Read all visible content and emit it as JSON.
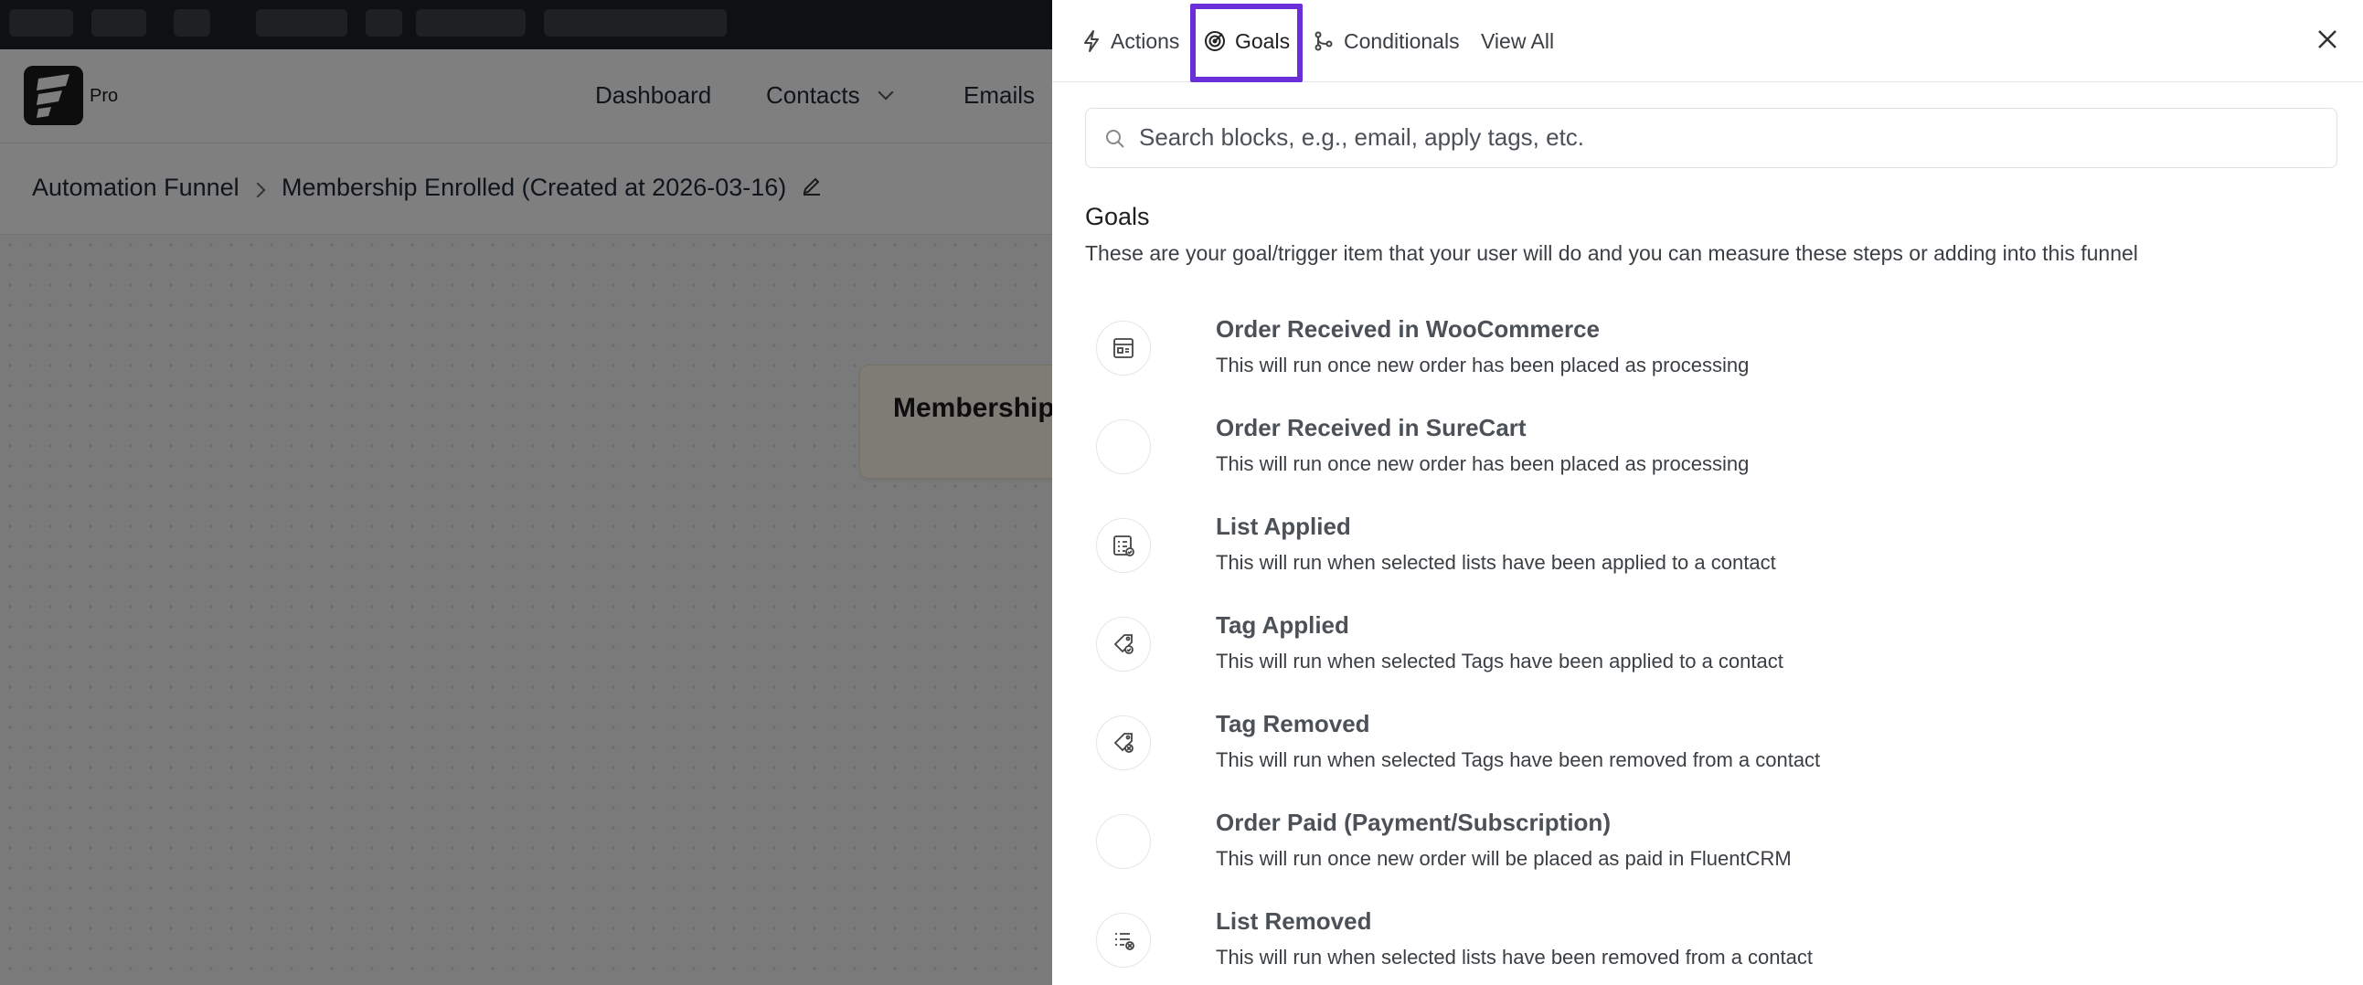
{
  "app": {
    "logo_suffix": "Pro",
    "nav": [
      {
        "label": "Dashboard"
      },
      {
        "label": "Contacts"
      },
      {
        "label": "Emails"
      }
    ],
    "breadcrumb": {
      "root": "Automation Funnel",
      "current": "Membership Enrolled (Created at 2026-03-16)"
    },
    "trigger_card_label": "Membership"
  },
  "panel": {
    "tabs": [
      {
        "label": "Actions",
        "icon": "lightning-icon"
      },
      {
        "label": "Goals",
        "icon": "target-icon",
        "active": true
      },
      {
        "label": "Conditionals",
        "icon": "branch-icon"
      },
      {
        "label": "View All"
      }
    ],
    "search": {
      "placeholder": "Search blocks, e.g., email, apply tags, etc."
    },
    "section": {
      "title": "Goals",
      "description": "These are your goal/trigger item that your user will do and you can measure these steps or adding into this funnel"
    },
    "goals": [
      {
        "title": "Order Received in WooCommerce",
        "desc": "This will run once new order has been placed as processing",
        "icon": "order-icon"
      },
      {
        "title": "Order Received in SureCart",
        "desc": "This will run once new order has been placed as processing",
        "icon": "blank-icon"
      },
      {
        "title": "List Applied",
        "desc": "This will run when selected lists have been applied to a contact",
        "icon": "list-icon"
      },
      {
        "title": "Tag Applied",
        "desc": "This will run when selected Tags have been applied to a contact",
        "icon": "tag-icon"
      },
      {
        "title": "Tag Removed",
        "desc": "This will run when selected Tags have been removed from a contact",
        "icon": "tag-icon"
      },
      {
        "title": "Order Paid (Payment/Subscription)",
        "desc": "This will run once new order will be placed as paid in FluentCRM",
        "icon": "blank-icon"
      },
      {
        "title": "List Removed",
        "desc": "This will run when selected lists have been removed from a contact",
        "icon": "list-remove-icon"
      }
    ]
  }
}
